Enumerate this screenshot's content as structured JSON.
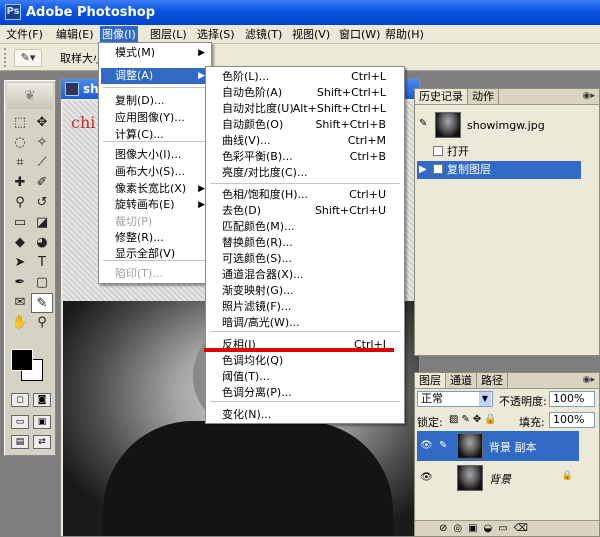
{
  "app": {
    "title": "Adobe Photoshop",
    "icon": "photoshop-icon"
  },
  "menubar": [
    "文件(F)",
    "编辑(E)",
    "图像(I)",
    "图层(L)",
    "选择(S)",
    "滤镜(T)",
    "视图(V)",
    "窗口(W)",
    "帮助(H)"
  ],
  "optbar": {
    "label": "取样大小",
    "tool_icon": "eyedropper-icon"
  },
  "document": {
    "title": "sho",
    "canvas_text": "chi"
  },
  "image_menu": [
    {
      "label": "模式(M)",
      "arrow": "▶"
    },
    {
      "label": "调整(A)",
      "arrow": "▶"
    },
    {
      "label": "复制(D)..."
    },
    {
      "label": "应用图像(Y)..."
    },
    {
      "label": "计算(C)..."
    },
    {
      "label": "图像大小(I)..."
    },
    {
      "label": "画布大小(S)..."
    },
    {
      "label": "像素长宽比(X)",
      "arrow": "▶"
    },
    {
      "label": "旋转画布(E)",
      "arrow": "▶"
    },
    {
      "label": "裁切(P)"
    },
    {
      "label": "修整(R)..."
    },
    {
      "label": "显示全部(V)"
    },
    {
      "label": "陷印(T)..."
    }
  ],
  "adjust_menu": [
    {
      "label": "色阶(L)...",
      "shortcut": "Ctrl+L"
    },
    {
      "label": "自动色阶(A)",
      "shortcut": "Shift+Ctrl+L"
    },
    {
      "label": "自动对比度(U)",
      "shortcut": "Alt+Shift+Ctrl+L"
    },
    {
      "label": "自动颜色(O)",
      "shortcut": "Shift+Ctrl+B"
    },
    {
      "label": "曲线(V)...",
      "shortcut": "Ctrl+M"
    },
    {
      "label": "色彩平衡(B)...",
      "shortcut": "Ctrl+B"
    },
    {
      "label": "亮度/对比度(C)...",
      "shortcut": ""
    },
    {
      "label": "色相/饱和度(H)...",
      "shortcut": "Ctrl+U"
    },
    {
      "label": "去色(D)",
      "shortcut": "Shift+Ctrl+U"
    },
    {
      "label": "匹配颜色(M)...",
      "shortcut": ""
    },
    {
      "label": "替换颜色(R)...",
      "shortcut": ""
    },
    {
      "label": "可选颜色(S)...",
      "shortcut": ""
    },
    {
      "label": "通道混合器(X)...",
      "shortcut": ""
    },
    {
      "label": "渐变映射(G)...",
      "shortcut": ""
    },
    {
      "label": "照片滤镜(F)...",
      "shortcut": ""
    },
    {
      "label": "暗调/高光(W)...",
      "shortcut": ""
    },
    {
      "label": "反相(I)",
      "shortcut": "Ctrl+I"
    },
    {
      "label": "色调均化(Q)",
      "shortcut": ""
    },
    {
      "label": "阈值(T)...",
      "shortcut": ""
    },
    {
      "label": "色调分离(P)...",
      "shortcut": ""
    },
    {
      "label": "变化(N)...",
      "shortcut": ""
    }
  ],
  "history_panel": {
    "tabs": [
      "历史记录",
      "动作"
    ],
    "snapshot": "showimgw.jpg",
    "items": [
      "打开",
      "复制图层"
    ]
  },
  "layers_panel": {
    "tabs": [
      "图层",
      "通道",
      "路径"
    ],
    "blend": "正常",
    "opacity_label": "不透明度:",
    "opacity": "100%",
    "lock_label": "锁定:",
    "fill_label": "填充:",
    "fill": "100%",
    "layers": [
      "背景 副本",
      "背景"
    ]
  },
  "colors": {
    "selection": "#316ac5",
    "highlight_line": "#e00000"
  }
}
